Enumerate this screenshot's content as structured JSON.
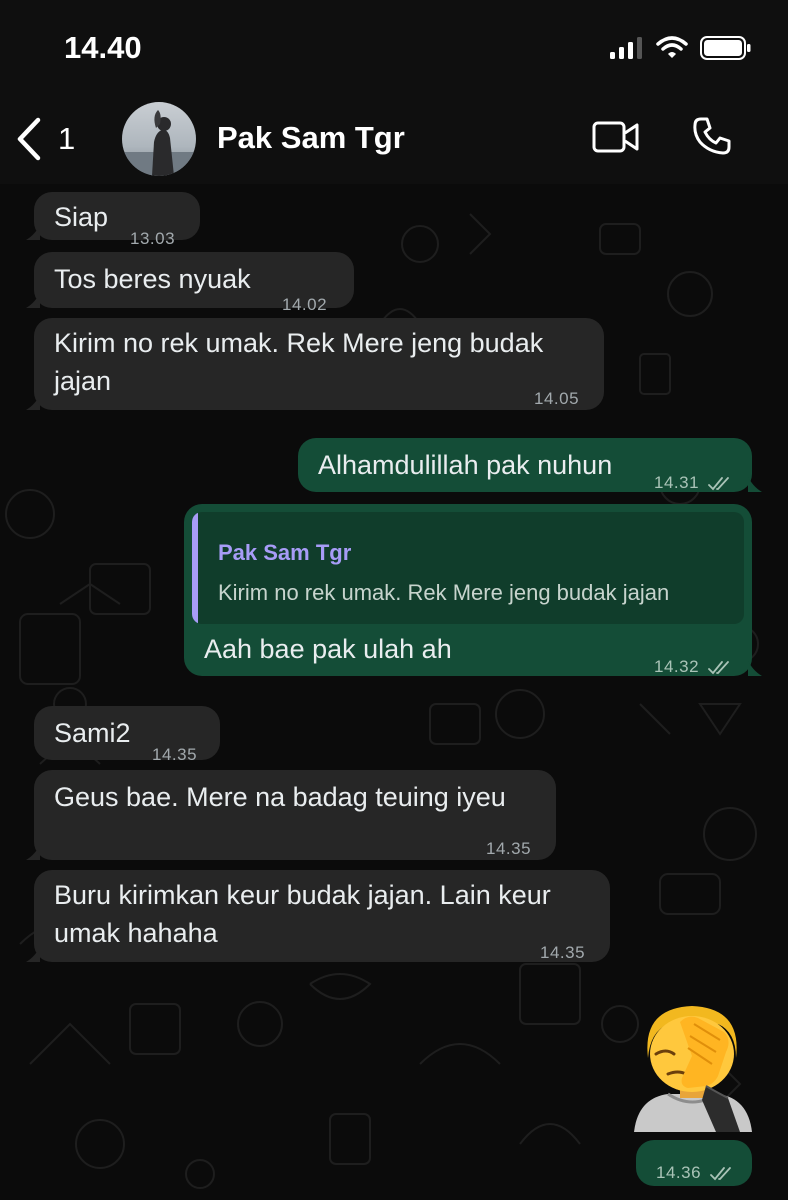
{
  "status_bar": {
    "time": "14.40",
    "icons": [
      "signal-icon",
      "wifi-icon",
      "battery-icon"
    ]
  },
  "header": {
    "back_count": "1",
    "contact_name": "Pak Sam Tgr",
    "icons": [
      "back-chevron-icon",
      "video-call-icon",
      "phone-call-icon"
    ]
  },
  "messages": [
    {
      "direction": "in",
      "text": "Siap",
      "time": "13.03"
    },
    {
      "direction": "in",
      "text": "Tos beres nyuak",
      "time": "14.02"
    },
    {
      "direction": "in",
      "text_line1": "Kirim no rek umak. Rek Mere jeng budak",
      "text_line2": "jajan",
      "time": "14.05"
    },
    {
      "direction": "out",
      "text": "Alhamdulillah pak nuhun",
      "time": "14.31"
    },
    {
      "direction": "out",
      "reply_to_name": "Pak Sam Tgr",
      "reply_to_text": "Kirim no rek umak. Rek Mere jeng budak jajan",
      "text": "Aah bae pak ulah ah",
      "time": "14.32"
    },
    {
      "direction": "in",
      "text": "Sami2",
      "time": "14.35"
    },
    {
      "direction": "in",
      "text": "Geus bae. Mere na badag teuing iyeu",
      "time": "14.35"
    },
    {
      "direction": "in",
      "text_line1": "Buru kirimkan keur budak jajan. Lain keur",
      "text_line2": "umak hahaha",
      "time": "14.35"
    },
    {
      "direction": "out",
      "emoji": "person-facepalming",
      "time": "14.36"
    }
  ],
  "colors": {
    "incoming_bubble": "#262626",
    "outgoing_bubble": "#144d37",
    "quote_accent": "#a79cf7",
    "background": "#0b0b0b"
  }
}
